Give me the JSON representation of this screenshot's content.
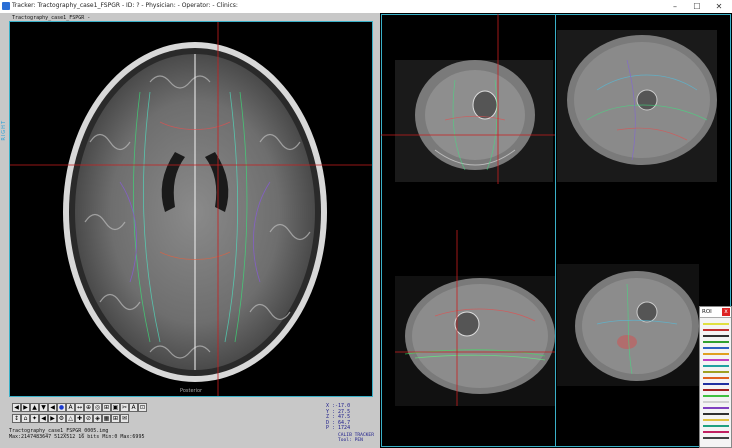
{
  "window": {
    "title": "Tracker: Tractography_case1_FSPGR - ID: ? - Physician: - Operator: - Clinics:",
    "controls": [
      "–",
      "☐",
      "✕"
    ]
  },
  "left_view": {
    "image_label": "Tractography_case1_FSPGR -",
    "side_label": "RIGHT",
    "bottom_label": "Posterior"
  },
  "coords": {
    "x": "X  :-17.0",
    "y": "Y  : 27.5",
    "z": "Z  : 47.5",
    "d": "D  : 64.7",
    "p": "P  : 1724"
  },
  "calib": {
    "line1": "CALIB TRACKER",
    "line2": "Tool: PEN"
  },
  "info": {
    "line1": "Tractography_case1_FSPGR_0005.img",
    "line2": "Max:2147483647 512X512 16 bits  Min:0  Max:6995"
  },
  "toolbar": {
    "row1": [
      "◀",
      "▶",
      "▲",
      "▼",
      "◀",
      "●",
      "A",
      "↔",
      "⊕",
      "◎",
      "⊞",
      "▣",
      "✂",
      "A",
      "⊡"
    ],
    "row2": [
      "↕",
      "⌂",
      "✦",
      "◀",
      "▶",
      "⚙",
      "△",
      "✚",
      "⊘",
      "◈",
      "▦",
      "⊞",
      "✉"
    ]
  },
  "roi": {
    "title": "ROI",
    "close": "x",
    "colors": [
      "#e0e040",
      "#c03030",
      "#303030",
      "#30a030",
      "#3060c0",
      "#e0a020",
      "#c040c0",
      "#20a0a0",
      "#a0a020",
      "#e06020",
      "#2030a0",
      "#a02020",
      "#40c040",
      "#d0d0d0",
      "#8040c0",
      "#303030",
      "#e0c040",
      "#20a080",
      "#c02060",
      "#404040"
    ]
  },
  "colors": {
    "accent": "#3ab0c8",
    "crosshair": "#c81e1e"
  }
}
